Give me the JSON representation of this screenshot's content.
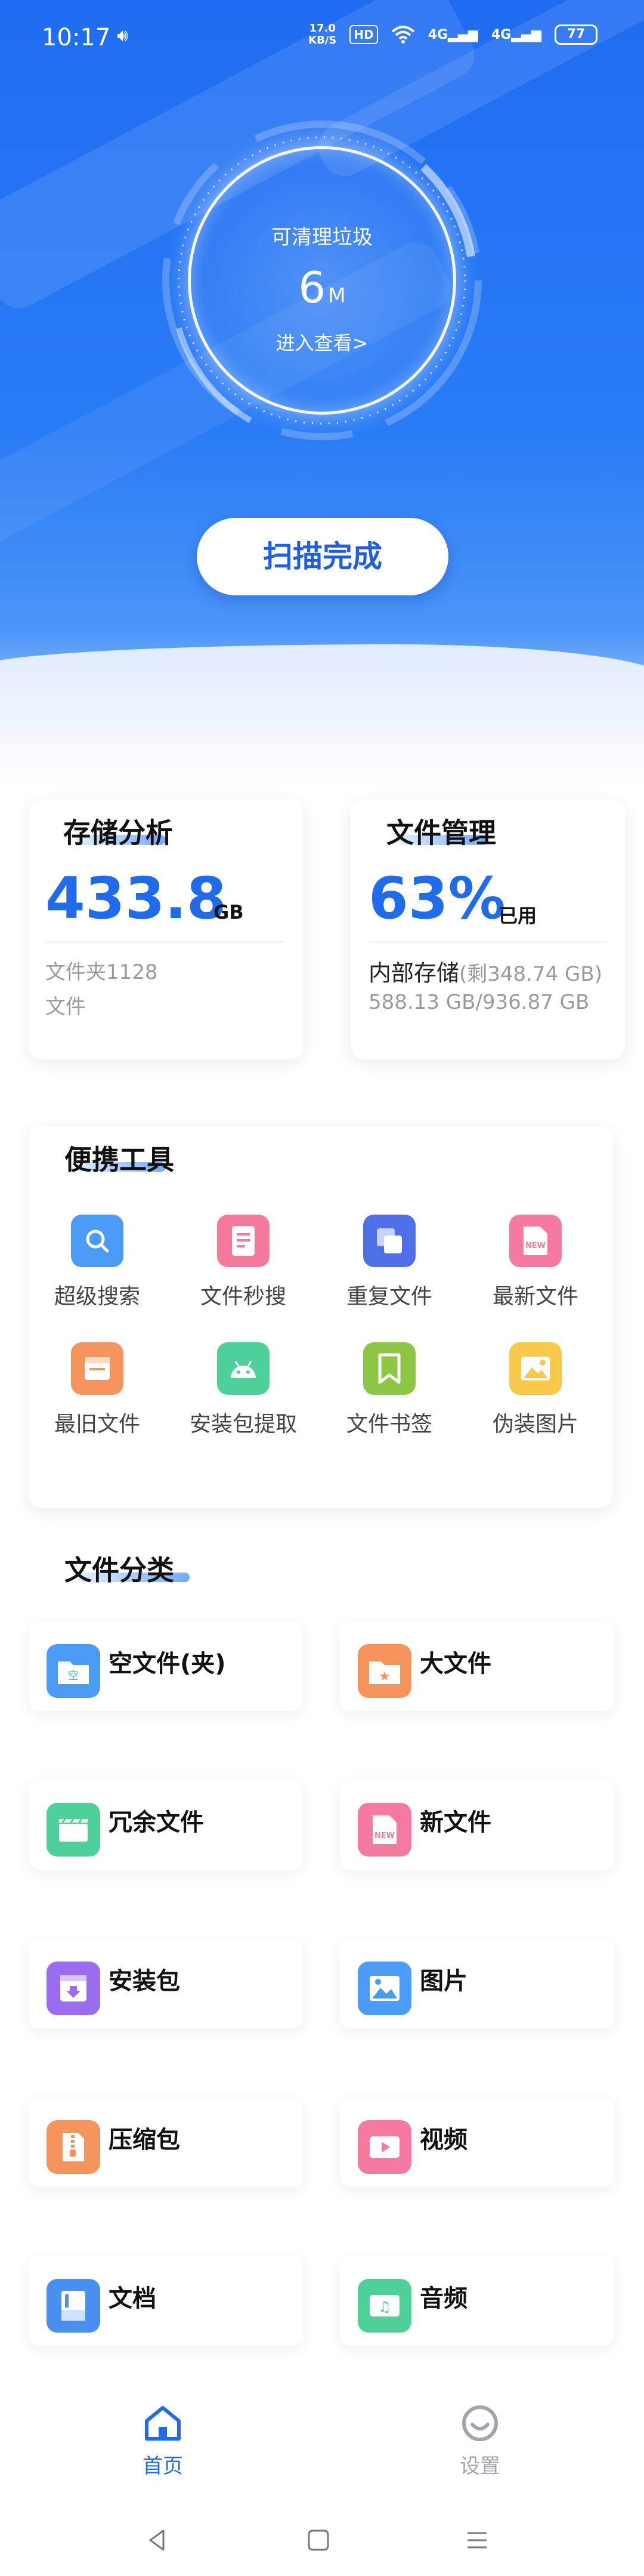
{
  "status_bar": {
    "time": "10:17",
    "speed_value": "17.0",
    "speed_unit": "KB/S",
    "hd_label": "HD",
    "network_1": "4G",
    "network_2": "4G",
    "battery": "77"
  },
  "hero": {
    "gauge_title": "可清理垃圾",
    "gauge_value": "6",
    "gauge_unit": "M",
    "gauge_link": "进入查看>",
    "scan_button": "扫描完成"
  },
  "storage": {
    "title": "存储分析",
    "value": "433.8",
    "unit": "GB",
    "folder_line1": "文件夹1128",
    "folder_line2": "文件"
  },
  "file_manager": {
    "title": "文件管理",
    "percent": "63%",
    "used_label": "已用",
    "internal_label": "内部存储",
    "remaining": "(剩348.74 GB)",
    "usage": "588.13 GB/936.87 GB"
  },
  "tools": {
    "title": "便携工具",
    "items": [
      {
        "label": "超级搜索",
        "icon": "search-icon",
        "color": "#4a9bf5"
      },
      {
        "label": "文件秒搜",
        "icon": "document-icon",
        "color": "#f4799b"
      },
      {
        "label": "重复文件",
        "icon": "duplicate-icon",
        "color": "#4f6fe6"
      },
      {
        "label": "最新文件",
        "icon": "new-file-icon",
        "color": "#f47aa0"
      },
      {
        "label": "最旧文件",
        "icon": "old-file-icon",
        "color": "#f5935d"
      },
      {
        "label": "安装包提取",
        "icon": "android-icon",
        "color": "#4fd09a"
      },
      {
        "label": "文件书签",
        "icon": "bookmark-icon",
        "color": "#8bc744"
      },
      {
        "label": "伪装图片",
        "icon": "image-icon",
        "color": "#f7c84a"
      }
    ]
  },
  "categories": {
    "title": "文件分类",
    "items": [
      {
        "label": "空文件(夹)",
        "icon": "empty-folder-icon",
        "color": "#4a9bf5",
        "glyph": "空"
      },
      {
        "label": "大文件",
        "icon": "large-file-icon",
        "color": "#f5935d",
        "glyph": "★"
      },
      {
        "label": "冗余文件",
        "icon": "redundant-file-icon",
        "color": "#4fd09a",
        "glyph": "▦"
      },
      {
        "label": "新文件",
        "icon": "new-file-icon",
        "color": "#f47aa0",
        "glyph": "NEW"
      },
      {
        "label": "安装包",
        "icon": "package-icon",
        "color": "#9a6cf0",
        "glyph": "⬇"
      },
      {
        "label": "图片",
        "icon": "picture-icon",
        "color": "#4a9bf5",
        "glyph": "▲"
      },
      {
        "label": "压缩包",
        "icon": "archive-icon",
        "color": "#f5935d",
        "glyph": "▮"
      },
      {
        "label": "视频",
        "icon": "video-icon",
        "color": "#f47aa0",
        "glyph": "▶"
      },
      {
        "label": "文档",
        "icon": "doc-icon",
        "color": "#4a8ef0",
        "glyph": "▤"
      },
      {
        "label": "音频",
        "icon": "audio-icon",
        "color": "#4fd09a",
        "glyph": "♫"
      }
    ]
  },
  "bottom_nav": {
    "home": "首页",
    "settings": "设置",
    "active_color": "#1f6be9",
    "inactive_color": "#a0a4ad"
  }
}
